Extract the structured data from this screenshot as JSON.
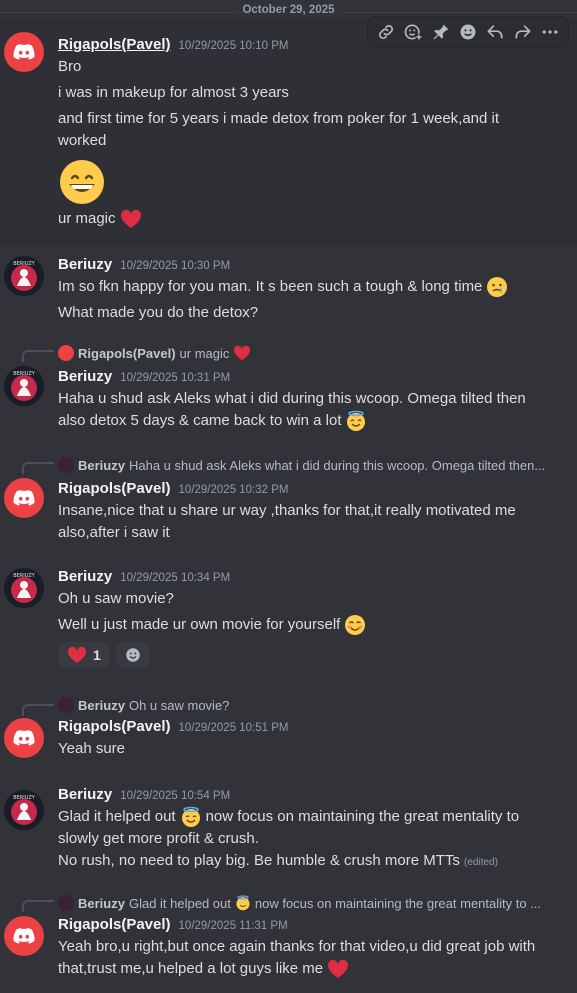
{
  "date_divider": "October 29, 2025",
  "toolbar": {
    "icons": [
      "link-icon",
      "add-reaction-icon",
      "pin-icon",
      "emoji-icon",
      "reply-icon",
      "forward-icon",
      "more-icon"
    ]
  },
  "users": {
    "rigapols": "Rigapols(Pavel)",
    "beriuzy": "Beriuzy"
  },
  "messages": [
    {
      "author": "Rigapols(Pavel)",
      "timestamp": "10/29/2025 10:10 PM",
      "lines": [
        "Bro",
        "i was in makeup for almost 3 years",
        "and first time for 5 years i made detox from poker for 1 week,and it",
        "worked",
        "ur magic"
      ]
    },
    {
      "author": "Beriuzy",
      "timestamp": "10/29/2025 10:30 PM",
      "lines": [
        "Im so fkn happy for you man. It s been such a tough & long time",
        "What made you do the detox?"
      ]
    },
    {
      "reply_to": {
        "author": "Rigapols(Pavel)",
        "text": "ur magic"
      },
      "author": "Beriuzy",
      "timestamp": "10/29/2025 10:31 PM",
      "lines": [
        "Haha u shud ask Aleks what i did during this wcoop. Omega tilted then",
        "also detox 5 days & came back to win a lot"
      ]
    },
    {
      "reply_to": {
        "author": "Beriuzy",
        "text": "Haha u shud ask Aleks what i did during this wcoop. Omega tilted then..."
      },
      "author": "Rigapols(Pavel)",
      "timestamp": "10/29/2025 10:32 PM",
      "lines": [
        "Insane,nice that u share ur way ,thanks for that,it really motivated me",
        "also,after i saw it"
      ]
    },
    {
      "author": "Beriuzy",
      "timestamp": "10/29/2025 10:34 PM",
      "lines": [
        "Oh u saw movie?",
        "Well u just made ur own movie for yourself"
      ],
      "reactions": [
        {
          "emoji": "heart",
          "count": "1"
        }
      ]
    },
    {
      "reply_to": {
        "author": "Beriuzy",
        "text": "Oh u saw movie?"
      },
      "author": "Rigapols(Pavel)",
      "timestamp": "10/29/2025 10:51 PM",
      "lines": [
        "Yeah sure"
      ]
    },
    {
      "author": "Beriuzy",
      "timestamp": "10/29/2025 10:54 PM",
      "lines": [
        "Glad it helped out",
        "now focus on maintaining the great mentality to",
        "slowly get more profit & crush.",
        "No rush, no need to play big. Be humble & crush more MTTs"
      ],
      "edited": "(edited)"
    },
    {
      "reply_to": {
        "author": "Beriuzy",
        "text_before": "Glad it helped out",
        "text_after": "now focus on maintaining the great mentality to ..."
      },
      "author": "Rigapols(Pavel)",
      "timestamp": "10/29/2025 11:31 PM",
      "lines": [
        "Yeah bro,u right,but once again thanks for that video,u did great job with",
        "that,trust me,u helped a lot guys like me"
      ]
    }
  ]
}
